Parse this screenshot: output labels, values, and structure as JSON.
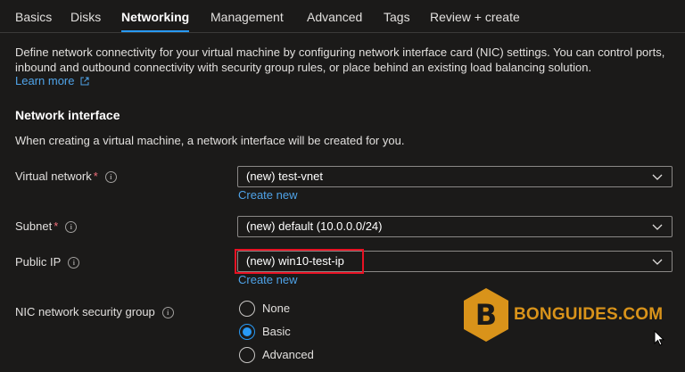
{
  "tabs": [
    {
      "label": "Basics"
    },
    {
      "label": "Disks"
    },
    {
      "label": "Networking"
    },
    {
      "label": "Management"
    },
    {
      "label": "Advanced"
    },
    {
      "label": "Tags"
    },
    {
      "label": "Review + create"
    }
  ],
  "active_tab": "Networking",
  "intro": {
    "text": "Define network connectivity for your virtual machine by configuring network interface card (NIC) settings. You can control ports, inbound and outbound connectivity with security group rules, or place behind an existing load balancing solution.",
    "learn_more": "Learn more"
  },
  "section": {
    "title": "Network interface",
    "description": "When creating a virtual machine, a network interface will be created for you."
  },
  "fields": {
    "virtual_network": {
      "label": "Virtual network",
      "required": "*",
      "value": "(new) test-vnet",
      "create_new": "Create new"
    },
    "subnet": {
      "label": "Subnet",
      "required": "*",
      "value": "(new) default (10.0.0.0/24)"
    },
    "public_ip": {
      "label": "Public IP",
      "value": "(new) win10-test-ip",
      "create_new": "Create new"
    },
    "nsg": {
      "label": "NIC network security group",
      "options": [
        {
          "label": "None"
        },
        {
          "label": "Basic"
        },
        {
          "label": "Advanced"
        }
      ],
      "selected": "Basic"
    }
  },
  "watermark": {
    "text": "BONGUIDES.COM",
    "letter": "B"
  },
  "colors": {
    "accent": "#2899f5",
    "background": "#1b1a19",
    "highlight": "#e81123",
    "watermark": "#d9931a"
  }
}
